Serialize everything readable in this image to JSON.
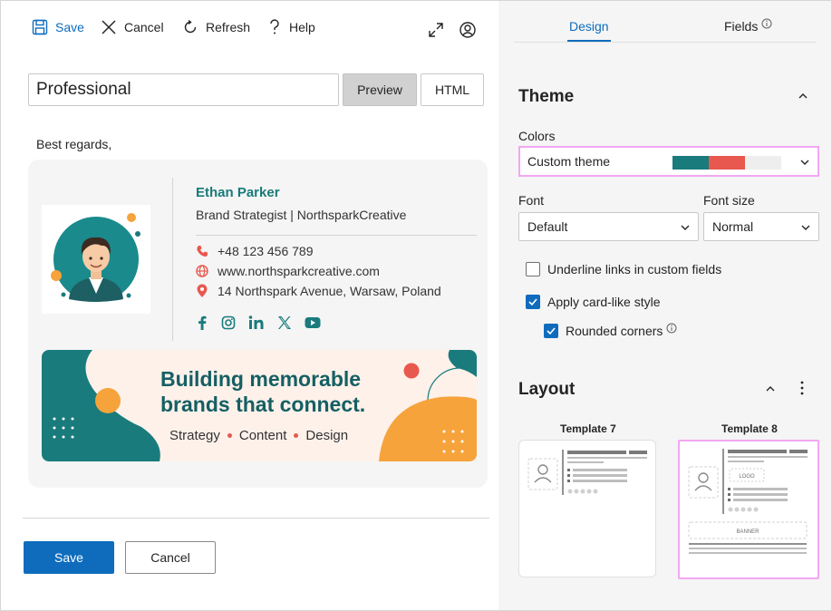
{
  "toolbar": {
    "save_label": "Save",
    "cancel_label": "Cancel",
    "refresh_label": "Refresh",
    "help_label": "Help"
  },
  "editor": {
    "signature_name": "Professional",
    "preview_label": "Preview",
    "html_label": "HTML",
    "closing_text": "Best regards,"
  },
  "signature": {
    "name": "Ethan Parker",
    "title": "Brand Strategist | NorthsparkCreative",
    "phone": "+48 123 456 789",
    "website": "www.northsparkcreative.com",
    "address": "14 Northspark Avenue, Warsaw, Poland",
    "socials": [
      "facebook-icon",
      "instagram-icon",
      "linkedin-icon",
      "x-icon",
      "youtube-icon"
    ],
    "banner": {
      "line1": "Building memorable",
      "line2": "brands that connect.",
      "tags": [
        "Strategy",
        "Content",
        "Design"
      ]
    }
  },
  "footer": {
    "save_label": "Save",
    "cancel_label": "Cancel"
  },
  "panel": {
    "tabs": [
      {
        "label": "Design",
        "active": true
      },
      {
        "label": "Fields",
        "active": false
      }
    ],
    "theme": {
      "title": "Theme",
      "colors_label": "Colors",
      "colors_value": "Custom theme",
      "swatches": [
        "#1a7b7d",
        "#e8584e",
        "#eeeeee"
      ],
      "font_label": "Font",
      "font_value": "Default",
      "font_size_label": "Font size",
      "font_size_value": "Normal",
      "underline_label": "Underline links in custom fields",
      "underline_checked": false,
      "card_label": "Apply card-like style",
      "card_checked": true,
      "rounded_label": "Rounded corners",
      "rounded_checked": true
    },
    "layout": {
      "title": "Layout",
      "templates": [
        {
          "label": "Template 7",
          "selected": false
        },
        {
          "label": "Template 8",
          "selected": true,
          "logo": "LOGO",
          "banner": "BANNER"
        }
      ]
    }
  },
  "colors": {
    "accent": "#0f6cbd",
    "brand_teal": "#1a7b7d",
    "brand_red": "#e8584e",
    "brand_orange": "#f6a33b",
    "selection_pink": "#f2a7f2"
  }
}
